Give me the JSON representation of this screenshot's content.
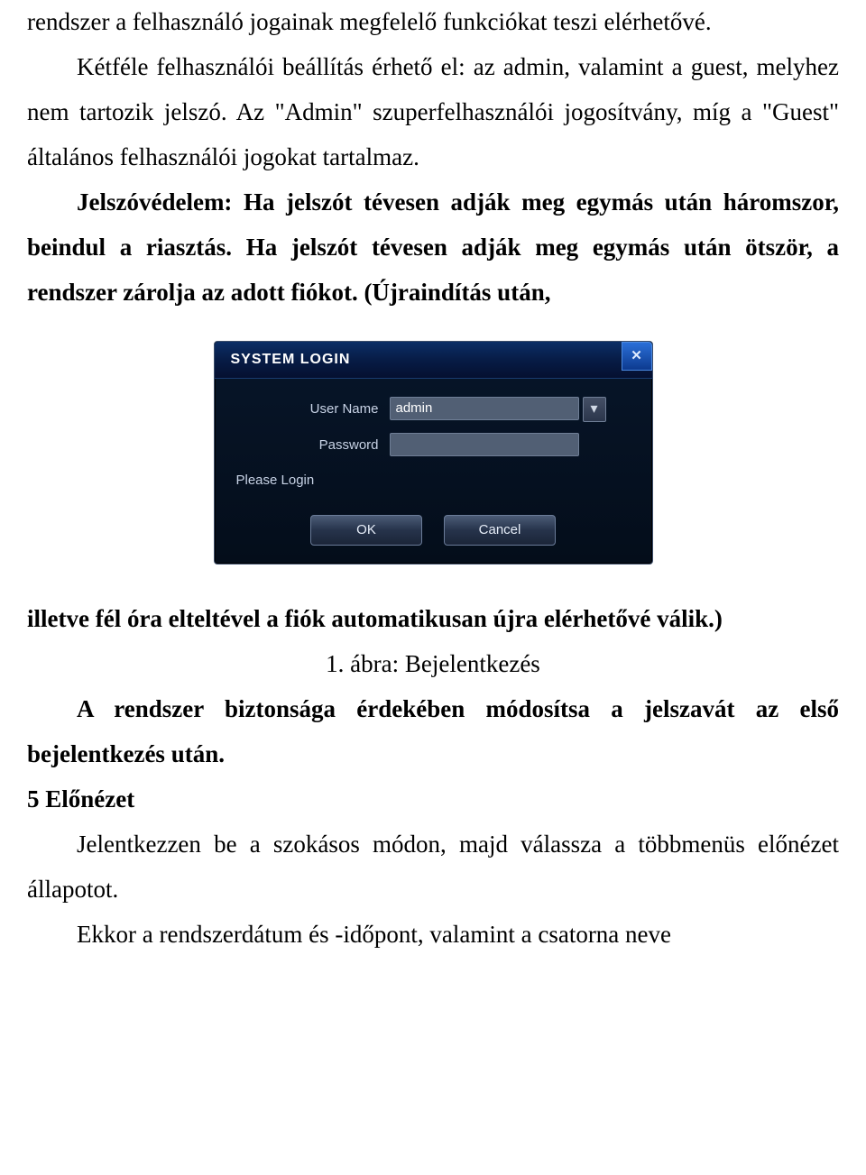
{
  "text": {
    "p1": "rendszer a felhasználó jogainak megfelelő funkciókat teszi elérhetővé.",
    "p2": "Kétféle felhasználói beállítás érhető el: az admin, valamint a guest, melyhez nem tartozik jelszó. Az \"Admin\" szuperfelhasználói jogosítvány, míg a \"Guest\" általános felhasználói jogokat tartalmaz.",
    "p3": "Jelszóvédelem: Ha jelszót tévesen adják meg egymás után háromszor, beindul a riasztás. Ha jelszót tévesen adják meg egymás után ötször, a rendszer zárolja az adott fiókot. (Újraindítás után,",
    "p4": "illetve fél óra elteltével a fiók automatikusan újra elérhetővé válik.)",
    "caption": "1. ábra: Bejelentkezés",
    "p5": "A rendszer biztonsága érdekében módosítsa a jelszavát az első bejelentkezés után.",
    "heading": "5 Előnézet",
    "p6": "Jelentkezzen be a szokásos módon, majd válassza a többmenüs előnézet állapotot.",
    "p7": "Ekkor a rendszerdátum és -időpont, valamint a csatorna neve"
  },
  "dialog": {
    "title": "SYSTEM LOGIN",
    "user_label": "User Name",
    "user_value": "admin",
    "password_label": "Password",
    "password_value": "",
    "please_login": "Please Login",
    "ok": "OK",
    "cancel": "Cancel",
    "close": "✕",
    "dropdown_glyph": "▾"
  }
}
